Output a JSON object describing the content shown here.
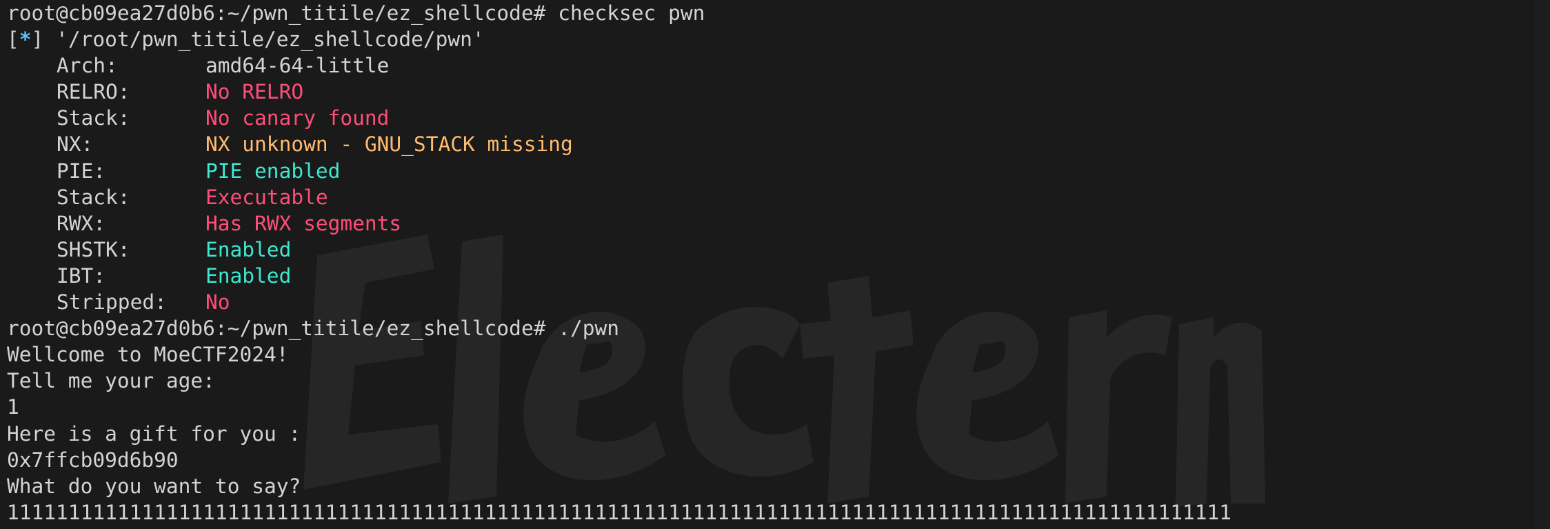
{
  "colors": {
    "background": "#1a1a1a",
    "text": "#d3d3d3",
    "info_marker": "#5ec3ff",
    "bad": "#ff4d7a",
    "warn": "#ffbb6e",
    "good": "#3ce8d0",
    "watermark": "#262626"
  },
  "watermark": {
    "text": "Electerm"
  },
  "terminal": {
    "prompt1": "root@cb09ea27d0b6:~/pwn_titile/ez_shellcode# checksec pwn",
    "info_open": "[",
    "info_star": "*",
    "info_rest": "] '/root/pwn_titile/ez_shellcode/pwn'",
    "checksec": [
      {
        "key": "Arch:",
        "value": "amd64-64-little",
        "status": "plain"
      },
      {
        "key": "RELRO:",
        "value": "No RELRO",
        "status": "red"
      },
      {
        "key": "Stack:",
        "value": "No canary found",
        "status": "red"
      },
      {
        "key": "NX:",
        "value": "NX unknown - GNU_STACK missing",
        "status": "orange"
      },
      {
        "key": "PIE:",
        "value": "PIE enabled",
        "status": "cyan"
      },
      {
        "key": "Stack:",
        "value": "Executable",
        "status": "red"
      },
      {
        "key": "RWX:",
        "value": "Has RWX segments",
        "status": "red"
      },
      {
        "key": "SHSTK:",
        "value": "Enabled",
        "status": "cyan"
      },
      {
        "key": "IBT:",
        "value": "Enabled",
        "status": "cyan"
      },
      {
        "key": "Stripped:",
        "value": "No",
        "status": "red"
      }
    ],
    "prompt2": "root@cb09ea27d0b6:~/pwn_titile/ez_shellcode# ./pwn",
    "output": [
      "Wellcome to MoeCTF2024!",
      "Tell me your age:",
      "1",
      "Here is a gift for you :",
      "0x7ffcb09d6b90",
      "What do you want to say?",
      "1111111111111111111111111111111111111111111111111111111111111111111111111111111111111111111111111111"
    ]
  }
}
